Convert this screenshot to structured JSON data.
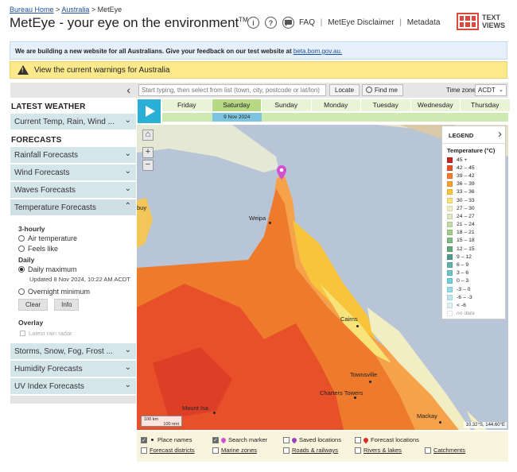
{
  "breadcrumb": {
    "home": "Bureau Home",
    "sep1": ">",
    "region": "Australia",
    "sep2": ">",
    "current": "MetEye"
  },
  "header": {
    "brand": "MetEye",
    "dash": "-",
    "tagline": "your eye on the environment",
    "tm": "TM",
    "icons": {
      "info": "i",
      "help": "?",
      "feedback": "speech-bubble-icon"
    },
    "links": [
      "FAQ",
      "MetEye Disclaimer",
      "Metadata"
    ],
    "separator": "|",
    "text_views_line1": "TEXT",
    "text_views_line2": "VIEWS"
  },
  "notice": {
    "text": "We are building a new website for all Australians. Give your feedback on our test website at",
    "link": "beta.bom.gov.au."
  },
  "warning": {
    "text": "View the current warnings for Australia"
  },
  "sidebar": {
    "latest_weather_heading": "LATEST WEATHER",
    "latest_weather_item": "Current Temp, Rain, Wind ...",
    "forecasts_heading": "FORECASTS",
    "forecast_items_top": [
      "Rainfall Forecasts",
      "Wind Forecasts",
      "Waves Forecasts"
    ],
    "open_item": "Temperature Forecasts",
    "panel": {
      "three_hourly": "3-hourly",
      "air_temp": "Air temperature",
      "feels_like": "Feels like",
      "daily": "Daily",
      "daily_max": "Daily maximum",
      "updated": "Updated 8 Nov 2024, 10:22 AM ACDT",
      "overnight_min": "Overnight minimum",
      "clear": "Clear",
      "info": "Info",
      "overlay": "Overlay",
      "latest_rain_radar": "Latest rain radar"
    },
    "forecast_items_bottom": [
      "Storms, Snow, Fog, Frost ...",
      "Humidity Forecasts",
      "UV Index Forecasts"
    ]
  },
  "search": {
    "placeholder": "Start typing, then select from list (town, city, postcode or lat/lon)",
    "locate": "Locate",
    "find_me": "Find me",
    "timezone_label": "Time zone",
    "timezone_value": "ACDT"
  },
  "days": [
    "Friday",
    "Saturday",
    "Sunday",
    "Monday",
    "Tuesday",
    "Wednesday",
    "Thursday"
  ],
  "selected_day": "Saturday",
  "selected_date": "9 Nov 2024",
  "map": {
    "towns": [
      "Weipa",
      "Cairns",
      "Townsville",
      "Charters Towers",
      "Mount Isa",
      "Mackay"
    ],
    "partial_label": "buy",
    "scale_km": "100 km",
    "scale_nmi": "100 nmi",
    "coords": "10.32°S, 144.60°E",
    "zoom_in": "+",
    "zoom_out": "−"
  },
  "legend": {
    "heading": "LEGEND",
    "title": "Temperature (°C)",
    "rows": [
      {
        "label": "45 +",
        "color": "#c62323"
      },
      {
        "label": "42 – 45",
        "color": "#e8502a"
      },
      {
        "label": "39 – 42",
        "color": "#f27a2c"
      },
      {
        "label": "36 – 39",
        "color": "#f7a131"
      },
      {
        "label": "33 – 36",
        "color": "#f8c43b"
      },
      {
        "label": "30 – 33",
        "color": "#f8e27a"
      },
      {
        "label": "27 – 30",
        "color": "#f2eec4"
      },
      {
        "label": "24 – 27",
        "color": "#dfe9c0"
      },
      {
        "label": "21 – 24",
        "color": "#c2dca5"
      },
      {
        "label": "18 – 21",
        "color": "#9fcd88"
      },
      {
        "label": "15 – 18",
        "color": "#7ebd7d"
      },
      {
        "label": "12 – 15",
        "color": "#63a87a"
      },
      {
        "label": "9 – 12",
        "color": "#4f9a8a"
      },
      {
        "label": "6 – 9",
        "color": "#5fb0ab"
      },
      {
        "label": "3 – 6",
        "color": "#6fc4c8"
      },
      {
        "label": "0 – 3",
        "color": "#6fd0e0"
      },
      {
        "label": "-3 – 0",
        "color": "#95dde9"
      },
      {
        "label": "-6 – -3",
        "color": "#b9e8ef"
      },
      {
        "label": "< -6",
        "color": "#dcf3f6"
      },
      {
        "label": "no data",
        "color": "#ffffff"
      }
    ]
  },
  "layers": {
    "place_names": "Place names",
    "search_marker": "Search marker",
    "saved_locations": "Saved locations",
    "forecast_locations": "Forecast locations",
    "forecast_districts": "Forecast districts",
    "marine_zones": "Marine zones",
    "roads_railways": "Roads & railways",
    "rivers_lakes": "Rivers & lakes",
    "catchments": "Catchments",
    "check": "✓"
  }
}
